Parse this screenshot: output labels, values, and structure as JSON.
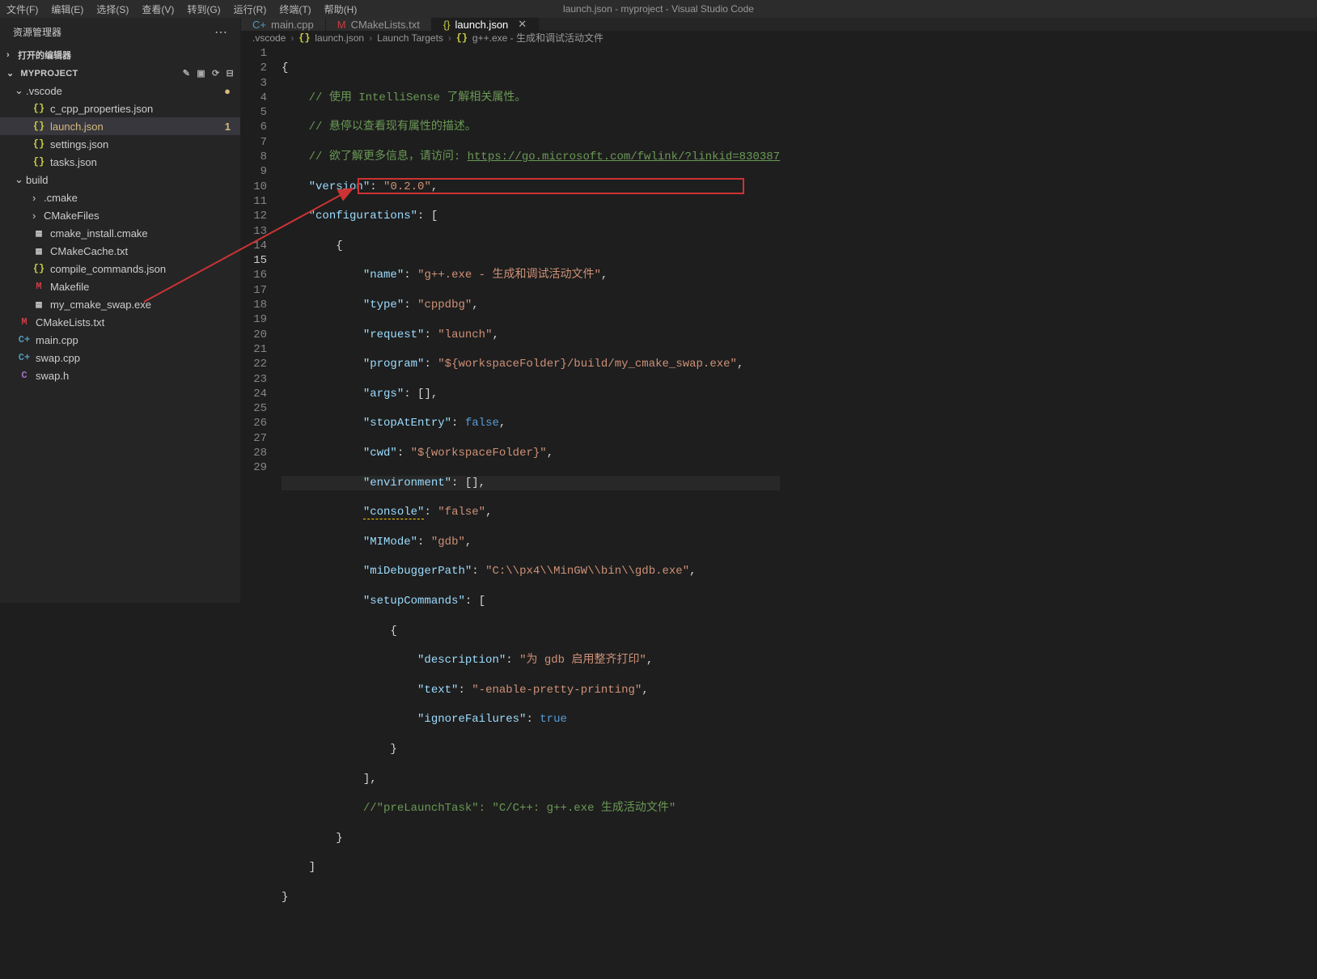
{
  "menu": {
    "file": "文件(F)",
    "edit": "编辑(E)",
    "select": "选择(S)",
    "view": "查看(V)",
    "go": "转到(G)",
    "run": "运行(R)",
    "terminal": "终端(T)",
    "help": "帮助(H)"
  },
  "window_title": "launch.json - myproject - Visual Studio Code",
  "sidebar_title": "资源管理器",
  "section_open_editors": "打开的编辑器",
  "section_project": "MYPROJECT",
  "tree": {
    "vscode": ".vscode",
    "c_cpp_properties": "c_cpp_properties.json",
    "launch": "launch.json",
    "launch_badge": "1",
    "settings": "settings.json",
    "tasks": "tasks.json",
    "build": "build",
    "cmake_dir": ".cmake",
    "cmakefiles": "CMakeFiles",
    "cmake_install": "cmake_install.cmake",
    "cmakecache": "CMakeCache.txt",
    "compile_commands": "compile_commands.json",
    "makefile": "Makefile",
    "my_cmake_swap": "my_cmake_swap.exe",
    "cmakelists": "CMakeLists.txt",
    "main_cpp": "main.cpp",
    "swap_cpp": "swap.cpp",
    "swap_h": "swap.h"
  },
  "tabs": {
    "main_cpp": "main.cpp",
    "cmakelists": "CMakeLists.txt",
    "launch": "launch.json"
  },
  "breadcrumb": {
    "p1": ".vscode",
    "p2": "launch.json",
    "p3": "Launch Targets",
    "p4": "g++.exe - 生成和调试活动文件"
  },
  "code": {
    "c1": "// 使用 IntelliSense 了解相关属性。",
    "c2": "// 悬停以查看现有属性的描述。",
    "c3_pre": "// 欲了解更多信息，请访问: ",
    "c3_link": "https://go.microsoft.com/fwlink/?linkid=830387",
    "k_version": "\"version\"",
    "v_version": "\"0.2.0\"",
    "k_configurations": "\"configurations\"",
    "k_name": "\"name\"",
    "v_name": "\"g++.exe - 生成和调试活动文件\"",
    "k_type": "\"type\"",
    "v_type": "\"cppdbg\"",
    "k_request": "\"request\"",
    "v_request": "\"launch\"",
    "k_program": "\"program\"",
    "v_program": "\"${workspaceFolder}/build/my_cmake_swap.exe\"",
    "k_args": "\"args\"",
    "k_stopAtEntry": "\"stopAtEntry\"",
    "v_false": "false",
    "k_cwd": "\"cwd\"",
    "v_cwd": "\"${workspaceFolder}\"",
    "k_environment": "\"environment\"",
    "k_console": "\"console\"",
    "v_console": "\"false\"",
    "k_mimode": "\"MIMode\"",
    "v_mimode": "\"gdb\"",
    "k_midbg": "\"miDebuggerPath\"",
    "v_midbg": "\"C:\\\\px4\\\\MinGW\\\\bin\\\\gdb.exe\"",
    "k_setup": "\"setupCommands\"",
    "k_desc": "\"description\"",
    "v_desc": "\"为 gdb 启用整齐打印\"",
    "k_text": "\"text\"",
    "v_text": "\"-enable-pretty-printing\"",
    "k_ignore": "\"ignoreFailures\"",
    "v_true": "true",
    "c_prelaunch": "//\"preLaunchTask\": \"C/C++: g++.exe 生成活动文件\""
  }
}
